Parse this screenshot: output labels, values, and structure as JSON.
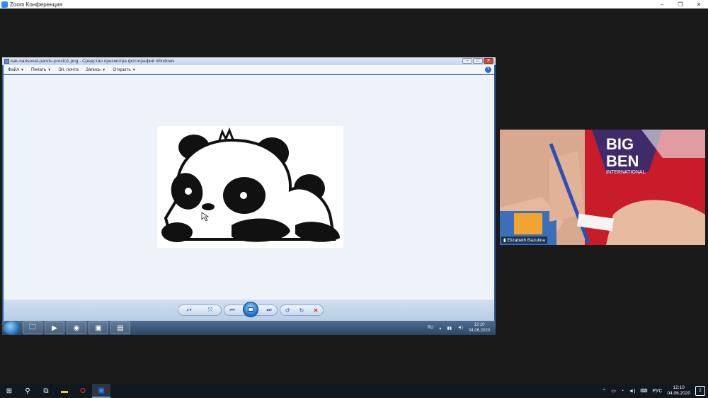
{
  "zoom": {
    "title": "Zoom Конференция",
    "minimize": "–",
    "maximize": "❐",
    "close": "✕"
  },
  "viewer": {
    "title": "kak-narisovat-pandu-prosto1.png - Средство просмотра фотографий Windows",
    "menu": [
      {
        "label": "Файл",
        "has_arrow": true
      },
      {
        "label": "Печать",
        "has_arrow": true
      },
      {
        "label": "Эл. почта",
        "has_arrow": false
      },
      {
        "label": "Запись",
        "has_arrow": true
      },
      {
        "label": "Открыть",
        "has_arrow": true
      }
    ],
    "help": "?",
    "window_controls": {
      "minimize": "–",
      "maximize": "□",
      "close": "✕"
    }
  },
  "toolbar": {
    "zoom_icon": "magnifier-icon",
    "fit_icon": "actual-size-icon",
    "prev_icon": "previous-icon",
    "slideshow_icon": "slideshow-icon",
    "next_icon": "next-icon",
    "rotate_left_icon": "rotate-ccw-icon",
    "rotate_right_icon": "rotate-cw-icon",
    "delete_icon": "delete-icon"
  },
  "remote_taskbar": {
    "apps": [
      "explorer-icon",
      "media-player-icon",
      "chrome-icon",
      "zoom-icon",
      "photo-viewer-icon"
    ],
    "lang": "RU",
    "time": "12:10",
    "date": "04.06.2020"
  },
  "camera": {
    "participant_name": "Elizabeth Bazulina",
    "shirt_text_1": "BIG",
    "shirt_text_2": "BEN",
    "shirt_text_3": "INTERNATIONAL"
  },
  "taskbar": {
    "lang": "РУС",
    "time": "12:10",
    "date": "04.06.2020",
    "notifications": "2"
  },
  "colors": {
    "zoom_blue": "#2d8cff",
    "win7_glass": "#2c4766",
    "win10_bar": "#101820"
  }
}
